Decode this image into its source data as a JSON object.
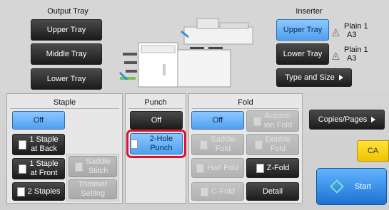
{
  "top": {
    "output_tray": {
      "title": "Output Tray",
      "upper": "Upper Tray",
      "middle": "Middle Tray",
      "lower": "Lower Tray"
    },
    "inserter": {
      "title": "Inserter",
      "upper": "Upper Tray",
      "lower": "Lower Tray",
      "upper_paper_type": "Plain 1",
      "upper_paper_size": "A3",
      "lower_paper_type": "Plain 1",
      "lower_paper_size": "A3",
      "type_and_size": "Type and Size"
    }
  },
  "staple": {
    "title": "Staple",
    "off": "Off",
    "one_back_line1": "1 Staple",
    "one_back_line2": "at Back",
    "one_front_line1": "1 Staple",
    "one_front_line2": "at Front",
    "two": "2 Staples",
    "saddle_line1": "Saddle",
    "saddle_line2": "Stitch",
    "trimmer_line1": "Trimmer",
    "trimmer_line2": "Setting"
  },
  "punch": {
    "title": "Punch",
    "off": "Off",
    "two_hole": "2-Hole Punch"
  },
  "fold": {
    "title": "Fold",
    "off": "Off",
    "accordion_line1": "Accord-",
    "accordion_line2": "ion Fold",
    "saddle_line1": "Saddle",
    "saddle_line2": "Fold",
    "double_line1": "Double",
    "double_line2": "Fold",
    "half": "Half Fold",
    "z": "Z-Fold",
    "c": "C-Fold",
    "detail": "Detail"
  },
  "right": {
    "copies_pages": "Copies/Pages",
    "ca": "CA",
    "start": "Start"
  },
  "colors": {
    "selected": "#5aaaf5",
    "highlight": "#d8152f",
    "ca": "#f5c800"
  }
}
